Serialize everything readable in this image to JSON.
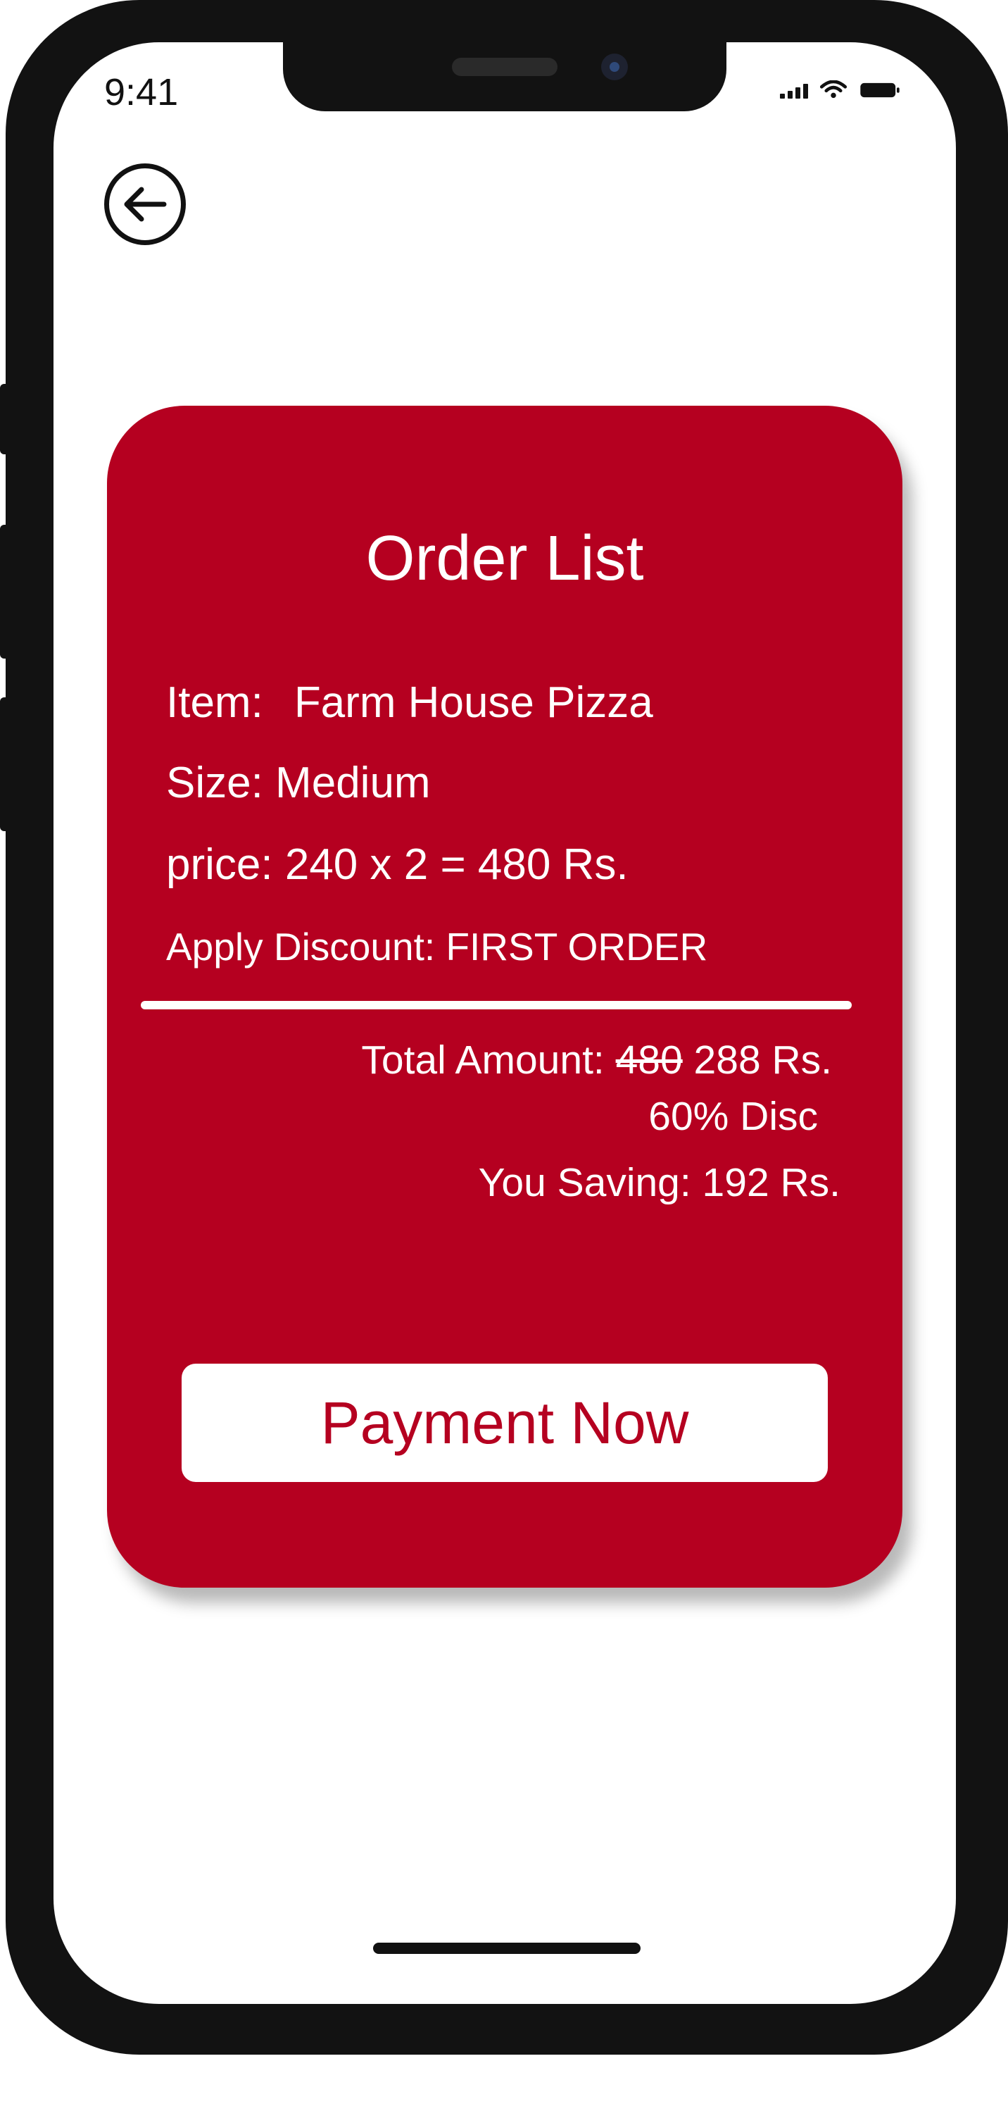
{
  "status_bar": {
    "time": "9:41",
    "icons": [
      "signal-icon",
      "wifi-icon",
      "battery-icon"
    ]
  },
  "header": {
    "back_icon": "back-arrow-icon"
  },
  "order": {
    "title": "Order List",
    "item_label": "Item:",
    "item_value": "Farm House Pizza",
    "size_text": "Size: Medium",
    "price_text": "price: 240 x 2 = 480 Rs.",
    "discount_text": "Apply Discount: FIRST ORDER",
    "total_label": "Total Amount: ",
    "total_original": "480",
    "total_final": " 288 Rs.",
    "discount_percent": "60% Disc",
    "saving_text": "You Saving: 192 Rs.",
    "pay_button_label": "Payment Now"
  },
  "colors": {
    "accent": "#b50020",
    "card_text": "#ffffff",
    "frame": "#121212",
    "background": "#ffffff"
  }
}
